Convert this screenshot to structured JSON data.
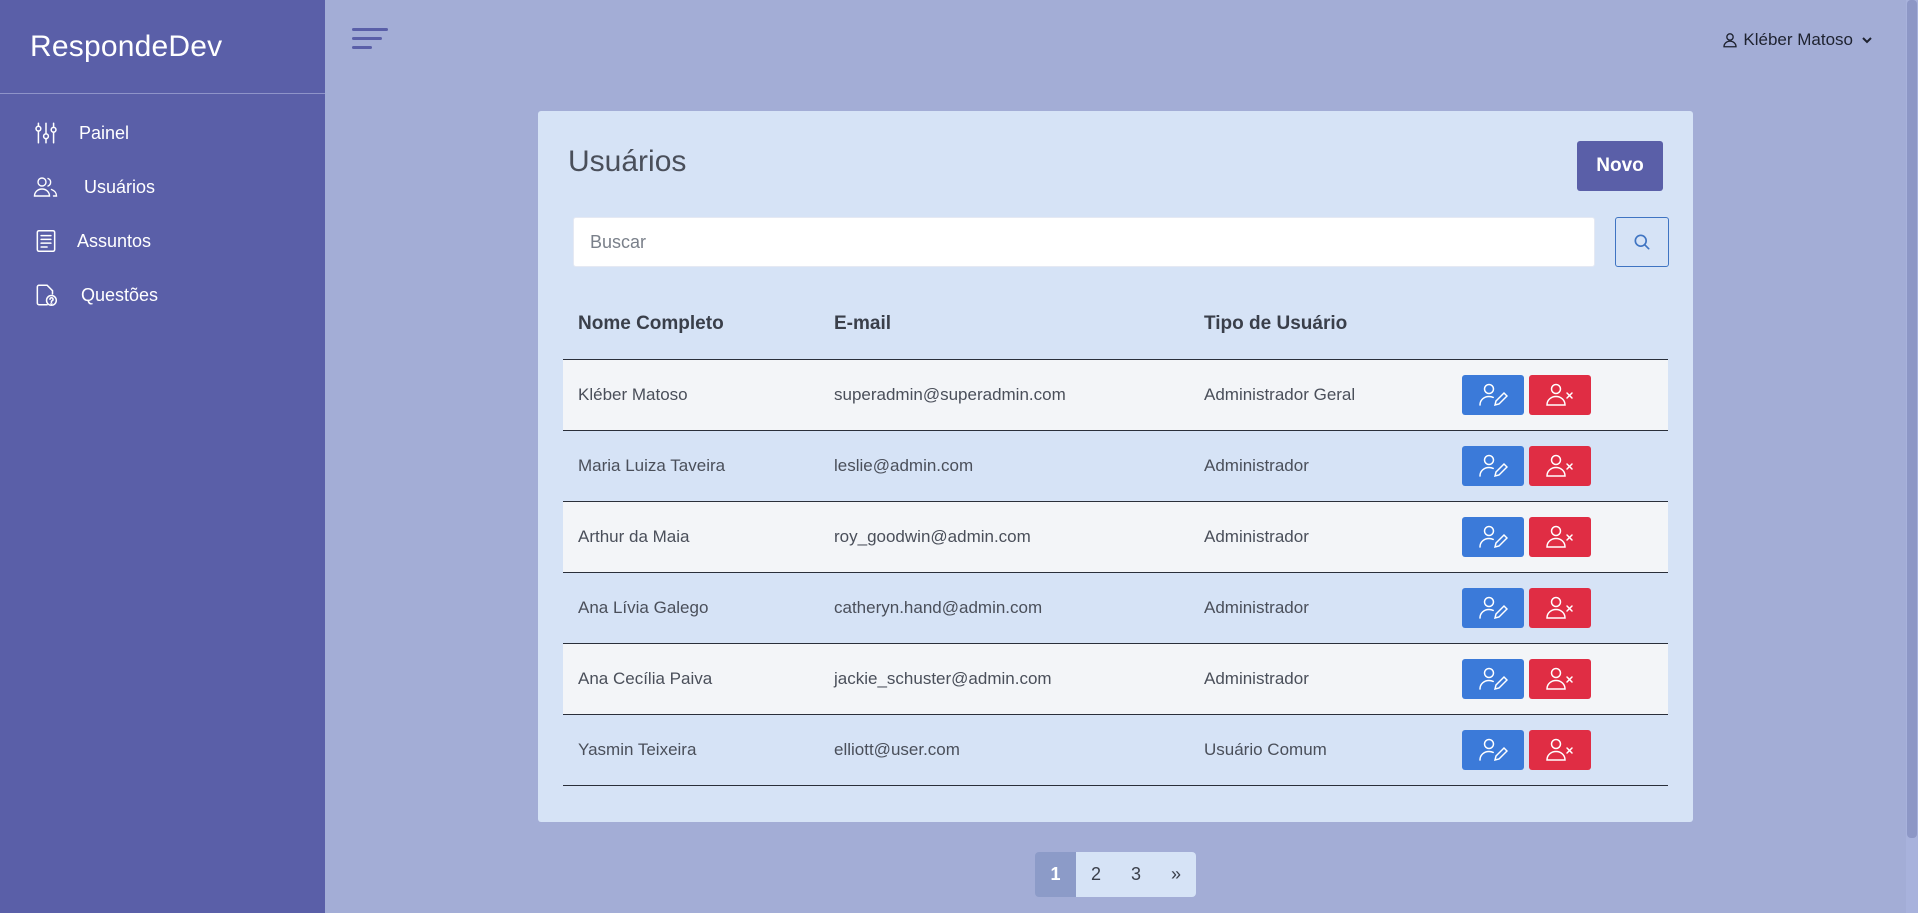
{
  "app": {
    "brand": "RespondeDev"
  },
  "sidebar": {
    "items": [
      {
        "label": "Painel",
        "icon": "sliders-icon"
      },
      {
        "label": "Usuários",
        "icon": "users-icon"
      },
      {
        "label": "Assuntos",
        "icon": "document-icon"
      },
      {
        "label": "Questões",
        "icon": "file-question-icon"
      }
    ]
  },
  "header": {
    "user_name": "Kléber Matoso"
  },
  "page": {
    "title": "Usuários",
    "new_label": "Novo",
    "search": {
      "placeholder": "Buscar",
      "value": ""
    }
  },
  "table": {
    "headers": [
      "Nome Completo",
      "E-mail",
      "Tipo de Usuário"
    ],
    "rows": [
      {
        "name": "Kléber Matoso",
        "email": "superadmin@superadmin.com",
        "type": "Administrador Geral"
      },
      {
        "name": "Maria Luiza Taveira",
        "email": "leslie@admin.com",
        "type": "Administrador"
      },
      {
        "name": "Arthur da Maia",
        "email": "roy_goodwin@admin.com",
        "type": "Administrador"
      },
      {
        "name": "Ana Lívia Galego",
        "email": "catheryn.hand@admin.com",
        "type": "Administrador"
      },
      {
        "name": "Ana Cecília Paiva",
        "email": "jackie_schuster@admin.com",
        "type": "Administrador"
      },
      {
        "name": "Yasmin Teixeira",
        "email": "elliott@user.com",
        "type": "Usuário Comum"
      }
    ]
  },
  "pagination": {
    "pages": [
      "1",
      "2",
      "3"
    ],
    "next": "»",
    "current": "1"
  },
  "colors": {
    "sidebar": "#5a5fa8",
    "primary": "#5a5fa8",
    "edit": "#3b7ad9",
    "delete": "#e02d44"
  }
}
